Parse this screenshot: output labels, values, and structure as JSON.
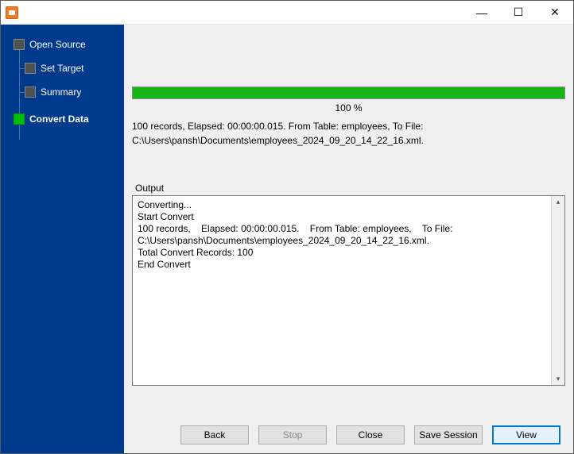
{
  "sidebar": {
    "items": [
      {
        "label": "Open Source",
        "level": "root",
        "active": false
      },
      {
        "label": "Set Target",
        "level": "child",
        "active": false
      },
      {
        "label": "Summary",
        "level": "child",
        "active": false
      },
      {
        "label": "Convert Data",
        "level": "root",
        "active": true
      }
    ]
  },
  "progress": {
    "percent_label": "100 %",
    "fill_percent": 100
  },
  "summary": {
    "line1": "100 records,    Elapsed: 00:00:00.015.    From Table: employees,    To File:",
    "line2": "C:\\Users\\pansh\\Documents\\employees_2024_09_20_14_22_16.xml."
  },
  "output": {
    "label": "Output",
    "text": "Converting...\nStart Convert\n100 records,    Elapsed: 00:00:00.015.    From Table: employees,    To File: C:\\Users\\pansh\\Documents\\employees_2024_09_20_14_22_16.xml.\nTotal Convert Records: 100\nEnd Convert"
  },
  "buttons": {
    "back": "Back",
    "stop": "Stop",
    "close": "Close",
    "save_session": "Save Session",
    "view": "View"
  },
  "window_controls": {
    "minimize": "—",
    "maximize": "☐",
    "close": "✕"
  }
}
